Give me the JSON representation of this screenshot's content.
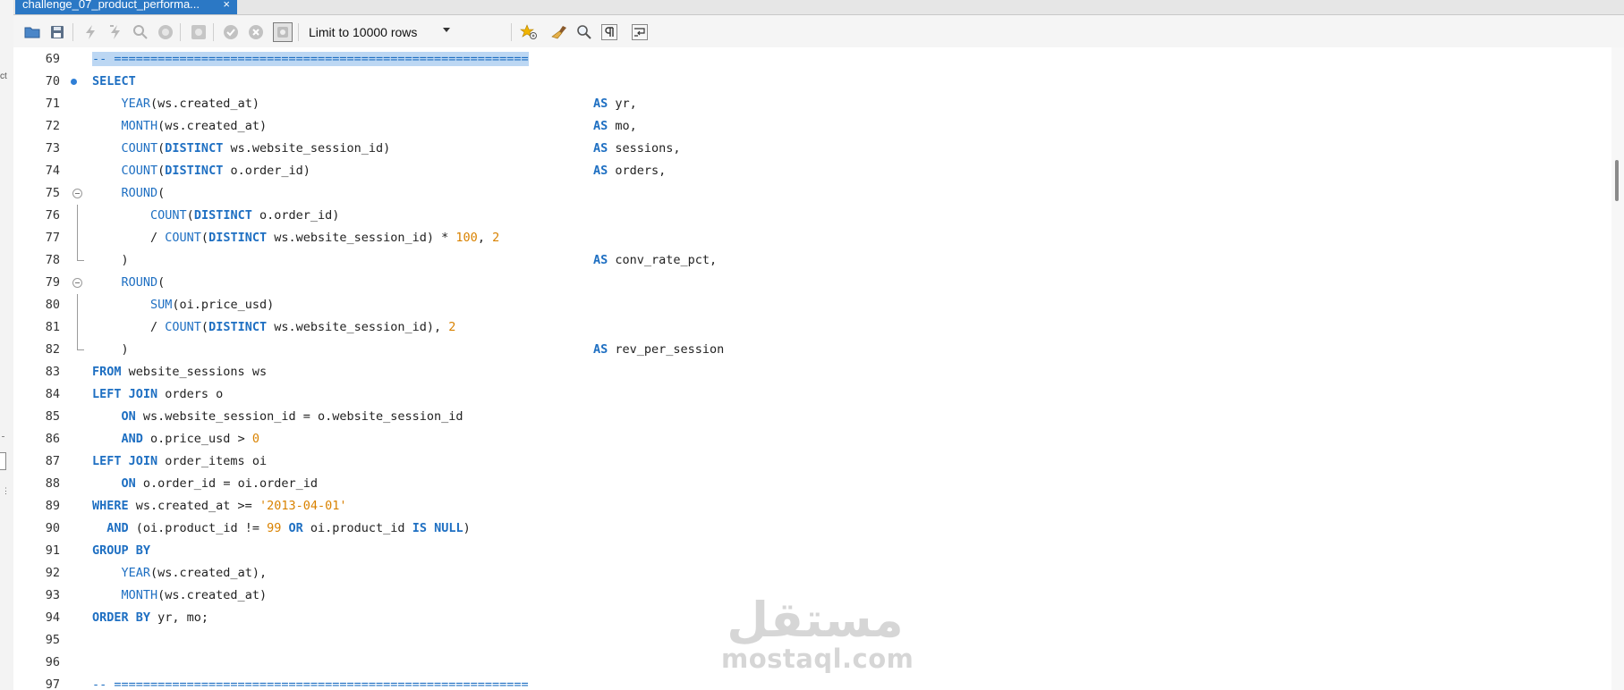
{
  "left_strip": {
    "fragment": "ct",
    "dots": "⋮"
  },
  "tab": {
    "title": "challenge_07_product_performa...",
    "close": "×"
  },
  "toolbar": {
    "limit_label": "Limit to 10000 rows"
  },
  "watermark": {
    "arabic": "مستقل",
    "latin": "mostaql.com"
  },
  "colors": {
    "keyword": "#1e6fc2",
    "number": "#d98200",
    "tab_active": "#2b78c5",
    "selection": "#bcd7f3"
  },
  "editor": {
    "lines": [
      {
        "n": "69",
        "parts": [
          {
            "t": "-- =========================================================",
            "c": "cm sel-hl"
          }
        ]
      },
      {
        "n": "70",
        "marker": "breakpoint",
        "parts": [
          {
            "t": "SELECT",
            "c": "kw"
          }
        ]
      },
      {
        "n": "71",
        "parts": [
          {
            "t": "    "
          },
          {
            "t": "YEAR",
            "c": "fn"
          },
          {
            "t": "(ws.created_at)"
          }
        ],
        "as": [
          {
            "t": "AS",
            "c": "kw"
          },
          {
            "t": " yr,"
          }
        ]
      },
      {
        "n": "72",
        "parts": [
          {
            "t": "    "
          },
          {
            "t": "MONTH",
            "c": "fn"
          },
          {
            "t": "(ws.created_at)"
          }
        ],
        "as": [
          {
            "t": "AS",
            "c": "kw"
          },
          {
            "t": " mo,"
          }
        ]
      },
      {
        "n": "73",
        "parts": [
          {
            "t": "    "
          },
          {
            "t": "COUNT",
            "c": "fn"
          },
          {
            "t": "("
          },
          {
            "t": "DISTINCT",
            "c": "kw"
          },
          {
            "t": " ws.website_session_id)"
          }
        ],
        "as": [
          {
            "t": "AS",
            "c": "kw"
          },
          {
            "t": " sessions,"
          }
        ]
      },
      {
        "n": "74",
        "parts": [
          {
            "t": "    "
          },
          {
            "t": "COUNT",
            "c": "fn"
          },
          {
            "t": "("
          },
          {
            "t": "DISTINCT",
            "c": "kw"
          },
          {
            "t": " o.order_id)"
          }
        ],
        "as": [
          {
            "t": "AS",
            "c": "kw"
          },
          {
            "t": " orders,"
          }
        ]
      },
      {
        "n": "75",
        "marker": "fold-open",
        "parts": [
          {
            "t": "    "
          },
          {
            "t": "ROUND",
            "c": "fn"
          },
          {
            "t": "("
          }
        ]
      },
      {
        "n": "76",
        "marker": "fold-body",
        "parts": [
          {
            "t": "        "
          },
          {
            "t": "COUNT",
            "c": "fn"
          },
          {
            "t": "("
          },
          {
            "t": "DISTINCT",
            "c": "kw"
          },
          {
            "t": " o.order_id)"
          }
        ]
      },
      {
        "n": "77",
        "marker": "fold-body",
        "parts": [
          {
            "t": "        / "
          },
          {
            "t": "COUNT",
            "c": "fn"
          },
          {
            "t": "("
          },
          {
            "t": "DISTINCT",
            "c": "kw"
          },
          {
            "t": " ws.website_session_id) * "
          },
          {
            "t": "100",
            "c": "num"
          },
          {
            "t": ", "
          },
          {
            "t": "2",
            "c": "num"
          }
        ]
      },
      {
        "n": "78",
        "marker": "fold-end",
        "parts": [
          {
            "t": "    )"
          }
        ],
        "as": [
          {
            "t": "AS",
            "c": "kw"
          },
          {
            "t": " conv_rate_pct,"
          }
        ]
      },
      {
        "n": "79",
        "marker": "fold-open",
        "parts": [
          {
            "t": "    "
          },
          {
            "t": "ROUND",
            "c": "fn"
          },
          {
            "t": "("
          }
        ]
      },
      {
        "n": "80",
        "marker": "fold-body",
        "parts": [
          {
            "t": "        "
          },
          {
            "t": "SUM",
            "c": "fn"
          },
          {
            "t": "(oi.price_usd)"
          }
        ]
      },
      {
        "n": "81",
        "marker": "fold-body",
        "parts": [
          {
            "t": "        / "
          },
          {
            "t": "COUNT",
            "c": "fn"
          },
          {
            "t": "("
          },
          {
            "t": "DISTINCT",
            "c": "kw"
          },
          {
            "t": " ws.website_session_id), "
          },
          {
            "t": "2",
            "c": "num"
          }
        ]
      },
      {
        "n": "82",
        "marker": "fold-end",
        "parts": [
          {
            "t": "    )"
          }
        ],
        "as": [
          {
            "t": "AS",
            "c": "kw"
          },
          {
            "t": " rev_per_session"
          }
        ]
      },
      {
        "n": "83",
        "parts": [
          {
            "t": "FROM",
            "c": "kw"
          },
          {
            "t": " website_sessions ws"
          }
        ]
      },
      {
        "n": "84",
        "parts": [
          {
            "t": "LEFT JOIN",
            "c": "kw"
          },
          {
            "t": " orders o"
          }
        ]
      },
      {
        "n": "85",
        "parts": [
          {
            "t": "    "
          },
          {
            "t": "ON",
            "c": "kw"
          },
          {
            "t": " ws.website_session_id = o.website_session_id"
          }
        ]
      },
      {
        "n": "86",
        "parts": [
          {
            "t": "    "
          },
          {
            "t": "AND",
            "c": "kw"
          },
          {
            "t": " o.price_usd > "
          },
          {
            "t": "0",
            "c": "num"
          }
        ]
      },
      {
        "n": "87",
        "parts": [
          {
            "t": "LEFT JOIN",
            "c": "kw"
          },
          {
            "t": " order_items oi"
          }
        ]
      },
      {
        "n": "88",
        "parts": [
          {
            "t": "    "
          },
          {
            "t": "ON",
            "c": "kw"
          },
          {
            "t": " o.order_id = oi.order_id"
          }
        ]
      },
      {
        "n": "89",
        "parts": [
          {
            "t": "WHERE",
            "c": "kw"
          },
          {
            "t": " ws.created_at >= "
          },
          {
            "t": "'2013-04-01'",
            "c": "str"
          }
        ]
      },
      {
        "n": "90",
        "parts": [
          {
            "t": "  "
          },
          {
            "t": "AND",
            "c": "kw"
          },
          {
            "t": " (oi.product_id != "
          },
          {
            "t": "99",
            "c": "num"
          },
          {
            "t": " "
          },
          {
            "t": "OR",
            "c": "kw"
          },
          {
            "t": " oi.product_id "
          },
          {
            "t": "IS NULL",
            "c": "kw"
          },
          {
            "t": ")"
          }
        ]
      },
      {
        "n": "91",
        "parts": [
          {
            "t": "GROUP BY",
            "c": "kw"
          }
        ]
      },
      {
        "n": "92",
        "parts": [
          {
            "t": "    "
          },
          {
            "t": "YEAR",
            "c": "fn"
          },
          {
            "t": "(ws.created_at),"
          }
        ]
      },
      {
        "n": "93",
        "parts": [
          {
            "t": "    "
          },
          {
            "t": "MONTH",
            "c": "fn"
          },
          {
            "t": "(ws.created_at)"
          }
        ]
      },
      {
        "n": "94",
        "parts": [
          {
            "t": "ORDER BY",
            "c": "kw"
          },
          {
            "t": " yr, mo;"
          }
        ]
      },
      {
        "n": "95",
        "parts": []
      },
      {
        "n": "96",
        "parts": []
      },
      {
        "n": "97",
        "parts": [
          {
            "t": "-- =========================================================",
            "c": "cm"
          }
        ]
      }
    ]
  }
}
